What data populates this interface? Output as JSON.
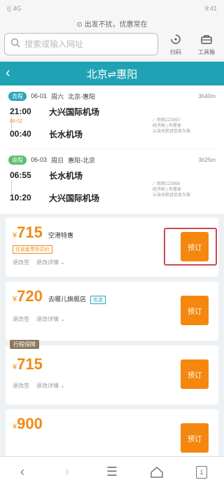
{
  "status_bar": {
    "left": "(( 4G",
    "right": "9:41"
  },
  "notice": {
    "text": "⊙ 出发不扰，优惠常在"
  },
  "search": {
    "placeholder": "搜索或输入网址",
    "qr_label": "扫码",
    "toolbox_label": "工具箱"
  },
  "header": {
    "title": "北京⇌惠阳"
  },
  "legs": [
    {
      "badge": "去程",
      "date": "06-01",
      "weekday": "周六",
      "route": "北京-惠阳",
      "duration": "3h40m",
      "dep_time": "21:00",
      "dep_airport": "大兴国际机场",
      "arr_time": "00:40",
      "arr_airport": "长水机场",
      "extra": "06-02",
      "info": [
        "⟋ 南航CZ3957",
        "经济舱 | 有餐食",
        "以当天航班信息为准"
      ]
    },
    {
      "badge": "返程",
      "date": "06-03",
      "weekday": "周日",
      "route": "惠阳-北京",
      "duration": "3h25m",
      "dep_time": "06:55",
      "dep_airport": "长水机场",
      "arr_time": "10:20",
      "arr_airport": "大兴国际机场",
      "extra": "",
      "info": [
        "⟋ 南航CZ3958",
        "经济舱 | 有餐食",
        "以当天航班信息为准"
      ]
    }
  ],
  "offers": [
    {
      "currency": "¥",
      "price": "715",
      "name": "空港特惠",
      "tag": "往返套票折扣价",
      "blue_tag": "",
      "corner": "",
      "links": [
        "退改签",
        "退改详情 ⌄"
      ],
      "button": "预订",
      "highlighted": true
    },
    {
      "currency": "¥",
      "price": "720",
      "name": "去哪儿旗舰店",
      "tag": "",
      "blue_tag": "优选",
      "corner": "",
      "links": [
        "退改签",
        "退改详情 ⌄"
      ],
      "button": "预订",
      "highlighted": false
    },
    {
      "currency": "¥",
      "price": "715",
      "name": "",
      "tag": "",
      "blue_tag": "",
      "corner": "行程保障",
      "links": [
        "退改签",
        "退改详情 ⌄"
      ],
      "button": "预订",
      "highlighted": false
    },
    {
      "currency": "¥",
      "price": "900",
      "name": "",
      "tag": "",
      "blue_tag": "",
      "corner": "",
      "links": [],
      "button": "预订",
      "highlighted": false
    }
  ],
  "bottom_nav": {
    "tab_count": "1"
  }
}
